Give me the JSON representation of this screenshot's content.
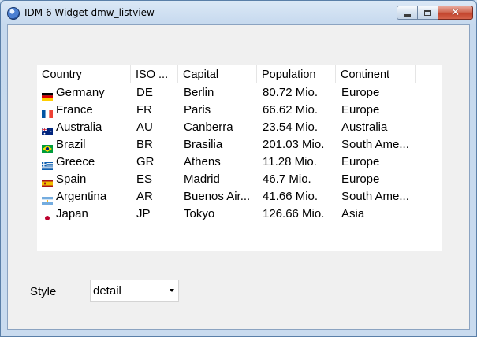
{
  "window": {
    "title": "IDM 6 Widget dmw_listview"
  },
  "listview": {
    "columns": [
      "Country",
      "ISO ...",
      "Capital",
      "Population",
      "Continent"
    ],
    "rows": [
      {
        "country": "Germany",
        "iso": "DE",
        "capital": "Berlin",
        "population": "80.72 Mio.",
        "continent": "Europe",
        "flag": "flag-germany-icon"
      },
      {
        "country": "France",
        "iso": "FR",
        "capital": "Paris",
        "population": "66.62 Mio.",
        "continent": "Europe",
        "flag": "flag-france-icon"
      },
      {
        "country": "Australia",
        "iso": "AU",
        "capital": "Canberra",
        "population": "23.54 Mio.",
        "continent": "Australia",
        "flag": "flag-australia-icon"
      },
      {
        "country": "Brazil",
        "iso": "BR",
        "capital": "Brasilia",
        "population": "201.03 Mio.",
        "continent": "South Ame...",
        "flag": "flag-brazil-icon"
      },
      {
        "country": "Greece",
        "iso": "GR",
        "capital": "Athens",
        "population": "11.28 Mio.",
        "continent": "Europe",
        "flag": "flag-greece-icon"
      },
      {
        "country": "Spain",
        "iso": "ES",
        "capital": "Madrid",
        "population": "46.7 Mio.",
        "continent": "Europe",
        "flag": "flag-spain-icon"
      },
      {
        "country": "Argentina",
        "iso": "AR",
        "capital": "Buenos Air...",
        "population": "41.66 Mio.",
        "continent": "South Ame...",
        "flag": "flag-argentina-icon"
      },
      {
        "country": "Japan",
        "iso": "JP",
        "capital": "Tokyo",
        "population": "126.66 Mio.",
        "continent": "Asia",
        "flag": "flag-japan-icon"
      }
    ]
  },
  "style": {
    "label": "Style",
    "selected": "detail"
  }
}
